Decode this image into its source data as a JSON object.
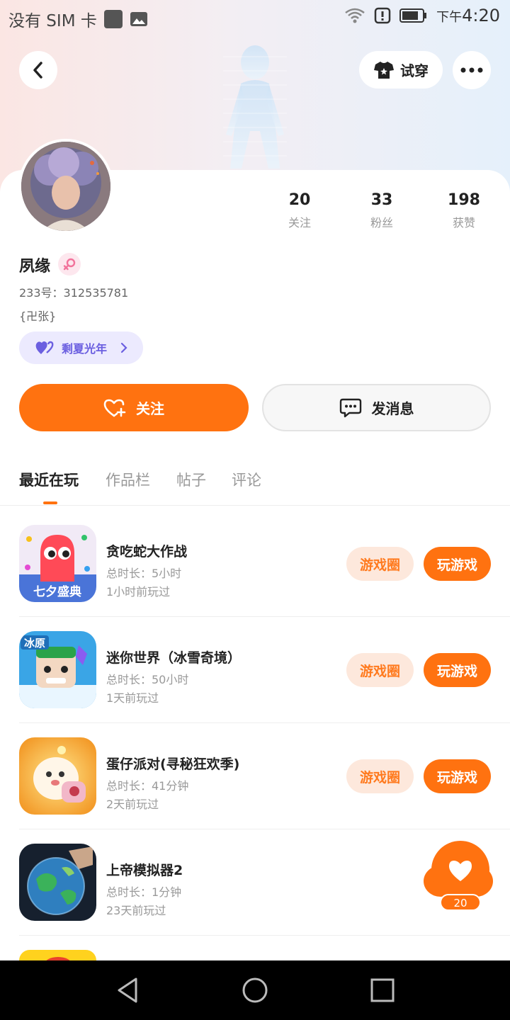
{
  "status_bar": {
    "carrier": "没有 SIM 卡",
    "time_prefix": "下午",
    "time": "4:20"
  },
  "header": {
    "try_on_label": "试穿",
    "icons": [
      "back-icon",
      "shirt-icon",
      "more-icon"
    ]
  },
  "profile": {
    "stats": [
      {
        "value": "20",
        "label": "关注"
      },
      {
        "value": "33",
        "label": "粉丝"
      },
      {
        "value": "198",
        "label": "获赞"
      }
    ],
    "name": "夙缘",
    "gender": "female",
    "id_text": "233号：312535781",
    "bio": "{卍张}",
    "badge_label": "剩夏光年"
  },
  "actions": {
    "follow_label": "关注",
    "message_label": "发消息"
  },
  "tabs": [
    {
      "label": "最近在玩",
      "active": true
    },
    {
      "label": "作品栏",
      "active": false
    },
    {
      "label": "帖子",
      "active": false
    },
    {
      "label": "评论",
      "active": false
    }
  ],
  "games": [
    {
      "title": "贪吃蛇大作战",
      "duration": "总时长：5小时",
      "last_played": "1小时前玩过",
      "circle_label": "游戏圈",
      "play_label": "玩游戏",
      "icon_text": "七夕盛典"
    },
    {
      "title": "迷你世界（冰雪奇境）",
      "duration": "总时长：50小时",
      "last_played": "1天前玩过",
      "circle_label": "游戏圈",
      "play_label": "玩游戏",
      "icon_text": "冰原"
    },
    {
      "title": "蛋仔派对(寻秘狂欢季)",
      "duration": "总时长：41分钟",
      "last_played": "2天前玩过",
      "circle_label": "游戏圈",
      "play_label": "玩游戏",
      "icon_text": ""
    },
    {
      "title": "上帝模拟器2",
      "duration": "总时长：1分钟",
      "last_played": "23天前玩过",
      "circle_label": "",
      "play_label": "",
      "icon_text": ""
    }
  ],
  "like_fab": {
    "count": "20"
  },
  "colors": {
    "accent": "#ff7210",
    "badge_bg": "#eceafe",
    "badge_text": "#6b5fe0"
  }
}
